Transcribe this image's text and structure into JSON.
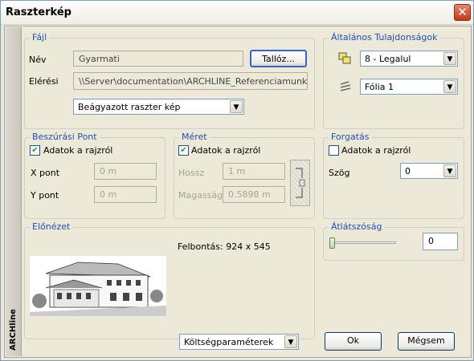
{
  "window": {
    "title": "Raszterkép",
    "side_tab": "ARCHline"
  },
  "file_group": {
    "legend": "Fájl",
    "name_label": "Név",
    "name_value": "Gyarmati",
    "browse_button": "Tallóz...",
    "path_label": "Elérési",
    "path_value": "\\\\Server\\documentation\\ARCHLINE_Referenciamunkak\\Felh",
    "embed_select": "Beágyazott raszter kép"
  },
  "general_group": {
    "legend": "Általános Tulajdonságok",
    "layer_select": "8 - Legalul",
    "sheet_select": "Fólia  1"
  },
  "insert_group": {
    "legend": "Beszúrási Pont",
    "checkbox_label": "Adatok a rajzról",
    "checked": true,
    "x_label": "X pont",
    "x_value": "0 m",
    "y_label": "Y pont",
    "y_value": "0 m"
  },
  "size_group": {
    "legend": "Méret",
    "checkbox_label": "Adatok a rajzról",
    "checked": true,
    "length_label": "Hossz",
    "length_value": "1 m",
    "height_label": "Magasság",
    "height_value": "0.5898 m"
  },
  "rotation_group": {
    "legend": "Forgatás",
    "checkbox_label": "Adatok a rajzról",
    "checked": false,
    "angle_label": "Szög",
    "angle_value": "0"
  },
  "preview_group": {
    "legend": "Előnézet",
    "resolution": "Felbontás: 924 x 545"
  },
  "transparency_group": {
    "legend": "Átlátszóság",
    "value": "0",
    "slider_fraction": 0
  },
  "footer": {
    "cost_params_select": "Költségparaméterek",
    "ok_button": "Ok",
    "cancel_button": "Mégsem"
  }
}
